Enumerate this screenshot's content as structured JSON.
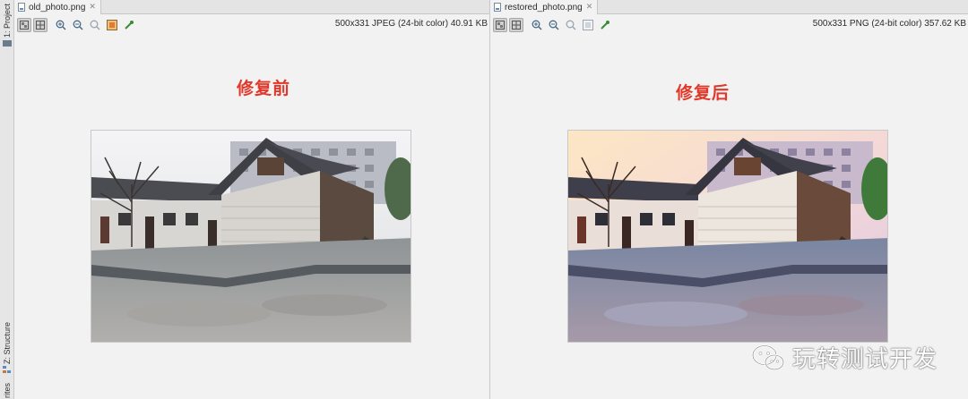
{
  "sidebar": {
    "project_tab": "1: Project",
    "structure_tab": "Z: Structure",
    "favorites_tab": "rites"
  },
  "left_pane": {
    "tab_name": "old_photo.png",
    "info": "500x331 JPEG (24-bit color) 40.91 KB",
    "caption": "修复前",
    "photo_variant": "faded"
  },
  "right_pane": {
    "tab_name": "restored_photo.png",
    "info": "500x331 PNG (24-bit color) 357.62 KB",
    "caption": "修复后",
    "photo_variant": "vivid"
  },
  "toolbar_icons": [
    "background-toggle-icon",
    "grid-toggle-icon",
    "zoom-in-icon",
    "zoom-out-icon",
    "actual-size-icon",
    "fit-icon",
    "color-picker-icon"
  ],
  "watermark": {
    "text": "玩转测试开发",
    "icon": "wechat-icon"
  },
  "colors": {
    "caption": "#e0392b",
    "active_button": "#d0d0d0",
    "background": "#f2f2f2"
  }
}
